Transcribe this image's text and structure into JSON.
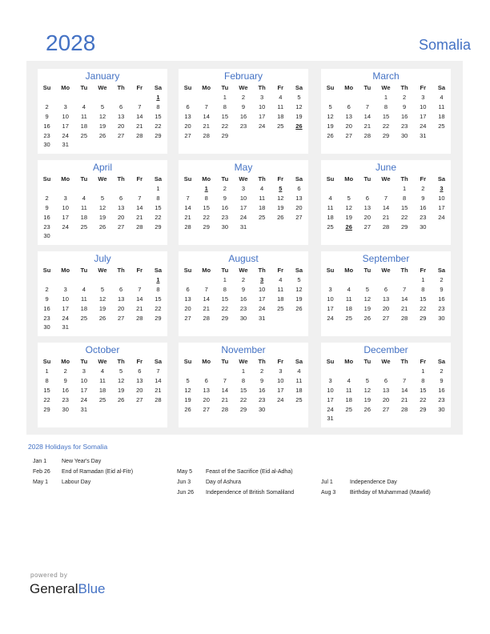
{
  "header": {
    "year": "2028",
    "country": "Somalia"
  },
  "weekdays": [
    "Su",
    "Mo",
    "Tu",
    "We",
    "Th",
    "Fr",
    "Sa"
  ],
  "months": [
    {
      "name": "January",
      "start": 6,
      "days": 31,
      "holidays": [
        1
      ]
    },
    {
      "name": "February",
      "start": 2,
      "days": 29,
      "holidays": [
        26
      ]
    },
    {
      "name": "March",
      "start": 3,
      "days": 31,
      "holidays": []
    },
    {
      "name": "April",
      "start": 6,
      "days": 30,
      "holidays": []
    },
    {
      "name": "May",
      "start": 1,
      "days": 31,
      "holidays": [
        1,
        5
      ]
    },
    {
      "name": "June",
      "start": 4,
      "days": 30,
      "holidays": [
        3,
        26
      ]
    },
    {
      "name": "July",
      "start": 6,
      "days": 31,
      "holidays": [
        1
      ]
    },
    {
      "name": "August",
      "start": 2,
      "days": 31,
      "holidays": [
        3
      ]
    },
    {
      "name": "September",
      "start": 5,
      "days": 30,
      "holidays": []
    },
    {
      "name": "October",
      "start": 0,
      "days": 31,
      "holidays": []
    },
    {
      "name": "November",
      "start": 3,
      "days": 30,
      "holidays": []
    },
    {
      "name": "December",
      "start": 5,
      "days": 31,
      "holidays": []
    }
  ],
  "holidays_section": {
    "title": "2028 Holidays for Somalia",
    "columns": [
      [
        {
          "date": "Jan 1",
          "name": "New Year's Day"
        },
        {
          "date": "Feb 26",
          "name": "End of Ramadan (Eid al-Fitr)"
        },
        {
          "date": "May 1",
          "name": "Labour Day"
        }
      ],
      [
        {
          "date": "May 5",
          "name": "Feast of the Sacrifice (Eid al-Adha)"
        },
        {
          "date": "Jun 3",
          "name": "Day of Ashura"
        },
        {
          "date": "Jun 26",
          "name": "Independence of British Somaliland"
        }
      ],
      [
        {
          "date": "Jul 1",
          "name": "Independence Day"
        },
        {
          "date": "Aug 3",
          "name": "Birthday of Muhammad (Mawlid)"
        }
      ]
    ]
  },
  "footer": {
    "powered_by": "powered by",
    "brand_part1": "General",
    "brand_part2": "Blue"
  },
  "colors": {
    "accent": "#4472c4",
    "holiday": "#e00000",
    "panel": "#f0f0f0"
  }
}
